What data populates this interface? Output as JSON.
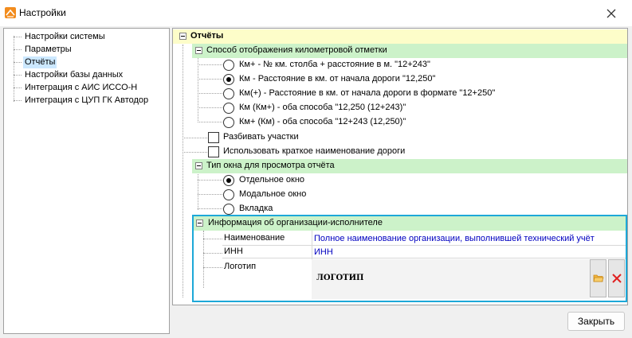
{
  "window": {
    "title": "Настройки",
    "app_icon": "ruler-icon",
    "close_icon": "close-icon"
  },
  "tree": {
    "items": [
      {
        "label": "Настройки системы",
        "selected": false
      },
      {
        "label": "Параметры",
        "selected": false
      },
      {
        "label": "Отчёты",
        "selected": true
      },
      {
        "label": "Настройки базы данных",
        "selected": false
      },
      {
        "label": "Интеграция с АИС ИССО-Н",
        "selected": false
      },
      {
        "label": "Интеграция с ЦУП ГК Автодор",
        "selected": false
      }
    ]
  },
  "reports": {
    "title": "Отчёты",
    "km_group": {
      "title": "Способ отображения километровой отметки",
      "options": [
        {
          "label": "Км+ - № км. столба + расстояние в м. \"12+243\"",
          "checked": false
        },
        {
          "label": "Км - Расстояние в км. от начала дороги \"12,250\"",
          "checked": true
        },
        {
          "label": "Км(+) - Расстояние в км. от начала дороги в формате \"12+250\"",
          "checked": false
        },
        {
          "label": "Км (Км+) - оба способа \"12,250 (12+243)\"",
          "checked": false
        },
        {
          "label": "Км+ (Км) - оба способа \"12+243 (12,250)\"",
          "checked": false
        }
      ]
    },
    "split_sections": {
      "label": "Разбивать участки",
      "checked": false
    },
    "short_road_name": {
      "label": "Использовать краткое наименование дороги",
      "checked": false
    },
    "window_group": {
      "title": "Тип окна для просмотра отчёта",
      "options": [
        {
          "label": "Отдельное окно",
          "checked": true
        },
        {
          "label": "Модальное окно",
          "checked": false
        },
        {
          "label": "Вкладка",
          "checked": false
        }
      ]
    },
    "org_group": {
      "title": "Информация об организации-исполнителе",
      "name_label": "Наименование",
      "name_value": "Полное наименование организации, выполнившей технический учёт",
      "inn_label": "ИНН",
      "inn_value": "ИНН",
      "logo_label": "Логотип",
      "logo_text": "ЛОГОТИП",
      "open_icon": "folder-open-icon",
      "clear_icon": "delete-x-icon"
    }
  },
  "footer": {
    "close_label": "Закрыть"
  },
  "colors": {
    "section_header": "#fdfdc9",
    "group_header": "#ccf2c9",
    "selection": "#cce8ff",
    "highlight_border": "#1da8d8",
    "value_text": "#0000c0",
    "folder": "#f2b33d",
    "delete": "#e02020"
  }
}
